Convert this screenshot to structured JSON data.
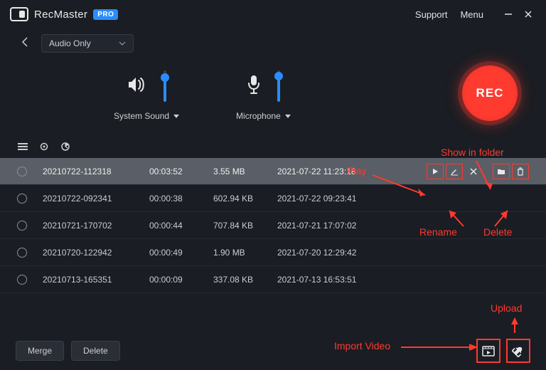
{
  "titlebar": {
    "app_name": "RecMaster",
    "badge": "PRO",
    "support": "Support",
    "menu": "Menu"
  },
  "mode": {
    "selected": "Audio Only"
  },
  "audio": {
    "system_label": "System Sound",
    "mic_label": "Microphone"
  },
  "rec_label": "REC",
  "recordings": [
    {
      "name": "20210722-112318",
      "duration": "00:03:52",
      "size": "3.55 MB",
      "date": "2021-07-22 11:23:18",
      "selected": true
    },
    {
      "name": "20210722-092341",
      "duration": "00:00:38",
      "size": "602.94 KB",
      "date": "2021-07-22 09:23:41",
      "selected": false
    },
    {
      "name": "20210721-170702",
      "duration": "00:00:44",
      "size": "707.84 KB",
      "date": "2021-07-21 17:07:02",
      "selected": false
    },
    {
      "name": "20210720-122942",
      "duration": "00:00:49",
      "size": "1.90 MB",
      "date": "2021-07-20 12:29:42",
      "selected": false
    },
    {
      "name": "20210713-165351",
      "duration": "00:00:09",
      "size": "337.08 KB",
      "date": "2021-07-13 16:53:51",
      "selected": false
    }
  ],
  "footer": {
    "merge": "Merge",
    "delete": "Delete"
  },
  "annotations": {
    "play": "Play",
    "show_in_folder": "Show in folder",
    "rename": "Rename",
    "delete": "Delete",
    "upload": "Upload",
    "import_video": "Import Video"
  }
}
